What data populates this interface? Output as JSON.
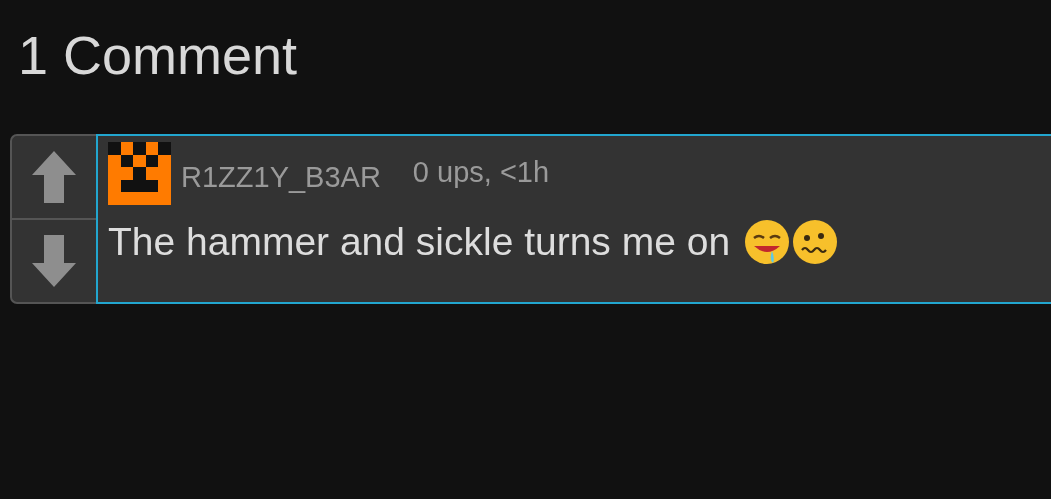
{
  "heading": "1 Comment",
  "comment": {
    "username": "R1ZZ1Y_B3AR",
    "meta": "0 ups, <1h",
    "text": "The hammer and sickle turns me on",
    "emojis": [
      {
        "kind": "drooling"
      },
      {
        "kind": "woozy"
      }
    ]
  }
}
